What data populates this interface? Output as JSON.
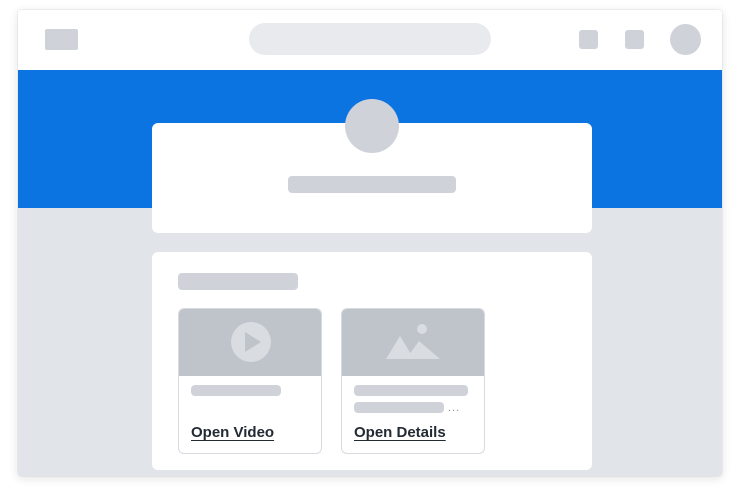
{
  "cards": {
    "video": {
      "link_label": "Open Video",
      "thumb_icon": "play-icon"
    },
    "details": {
      "link_label": "Open Details",
      "thumb_icon": "image-icon",
      "ellipsis": "..."
    }
  },
  "colors": {
    "hero": "#0b74e0",
    "background": "#e1e4e9",
    "placeholder": "#cfd3d9",
    "thumbnail": "#bfc4cb"
  }
}
